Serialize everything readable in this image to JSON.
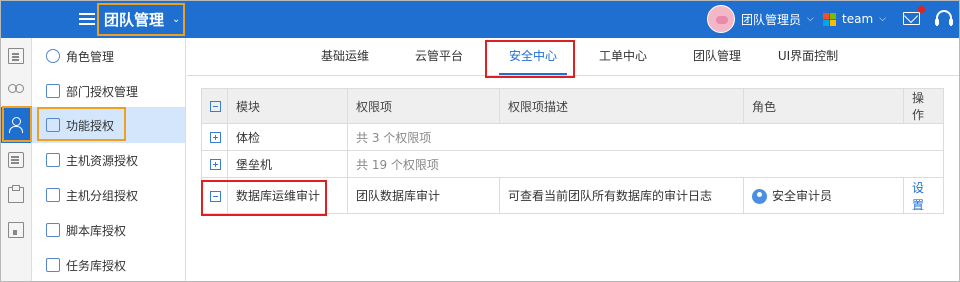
{
  "header": {
    "title": "团队管理",
    "user_name": "团队管理员",
    "team_name": "team",
    "brand_color": "#1e6fd0",
    "team_logo_colors": [
      "#f25022",
      "#7fba00",
      "#00a4ef",
      "#ffb900"
    ]
  },
  "rail": {
    "icons": [
      "document-icon",
      "users-icon",
      "person-settings-icon",
      "list-settings-icon",
      "clipboard-icon",
      "book-icon"
    ]
  },
  "sidebar": {
    "items": [
      {
        "label": "角色管理",
        "icon": "user-icon"
      },
      {
        "label": "部门授权管理",
        "icon": "org-icon"
      },
      {
        "label": "功能授权",
        "icon": "function-icon",
        "active": true
      },
      {
        "label": "主机资源授权",
        "icon": "monitor-icon"
      },
      {
        "label": "主机分组授权",
        "icon": "folder-icon"
      },
      {
        "label": "脚本库授权",
        "icon": "code-icon"
      },
      {
        "label": "任务库授权",
        "icon": "task-icon"
      }
    ]
  },
  "tabs": [
    {
      "label": "基础运维"
    },
    {
      "label": "云管平台"
    },
    {
      "label": "安全中心",
      "active": true
    },
    {
      "label": "工单中心"
    },
    {
      "label": "团队管理"
    },
    {
      "label": "UI界面控制"
    }
  ],
  "table": {
    "headers": {
      "module": "模块",
      "permission": "权限项",
      "description": "权限项描述",
      "role": "角色",
      "action": "操作"
    },
    "rows": [
      {
        "module": "体检",
        "summary": "共 3 个权限项"
      },
      {
        "module": "堡垒机",
        "summary": "共 19 个权限项"
      },
      {
        "module": "数据库运维审计",
        "permission": "团队数据库审计",
        "description": "可查看当前团队所有数据库的审计日志",
        "role": "安全审计员",
        "action": "设置"
      }
    ]
  }
}
